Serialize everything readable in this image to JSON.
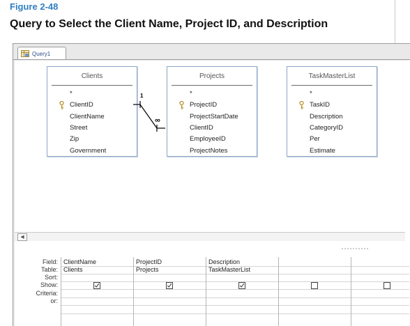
{
  "figure": {
    "label": "Figure 2-48",
    "title": "Query to Select the Client Name, Project ID, and Description"
  },
  "window": {
    "tab_label": "Query1",
    "tab_icon": "query-icon",
    "scroll_left_icon": "scroll-left-icon",
    "scroll_left_glyph": "◀"
  },
  "tables": [
    {
      "name": "Clients",
      "fields": [
        {
          "label": "*",
          "key": false
        },
        {
          "label": "ClientID",
          "key": true
        },
        {
          "label": "ClientName",
          "key": false
        },
        {
          "label": "Street",
          "key": false
        },
        {
          "label": "Zip",
          "key": false
        },
        {
          "label": "Government",
          "key": false
        }
      ]
    },
    {
      "name": "Projects",
      "fields": [
        {
          "label": "*",
          "key": false
        },
        {
          "label": "ProjectID",
          "key": true
        },
        {
          "label": "ProjectStartDate",
          "key": false
        },
        {
          "label": "ClientID",
          "key": false
        },
        {
          "label": "EmployeeID",
          "key": false
        },
        {
          "label": "ProjectNotes",
          "key": false
        }
      ]
    },
    {
      "name": "TaskMasterList",
      "fields": [
        {
          "label": "*",
          "key": false
        },
        {
          "label": "TaskID",
          "key": true
        },
        {
          "label": "Description",
          "key": false
        },
        {
          "label": "CategoryID",
          "key": false
        },
        {
          "label": "Per",
          "key": false
        },
        {
          "label": "Estimate",
          "key": false
        }
      ]
    }
  ],
  "relationship": {
    "one_side": "1",
    "many_side": "∞"
  },
  "grid": {
    "row_labels": {
      "field": "Field:",
      "table": "Table:",
      "sort": "Sort:",
      "show": "Show:",
      "criteria": "Criteria:",
      "or": "or:"
    },
    "columns": [
      {
        "field": "ClientName",
        "table": "Clients",
        "sort": "",
        "show": true,
        "criteria": "",
        "or": ""
      },
      {
        "field": "ProjectID",
        "table": "Projects",
        "sort": "",
        "show": true,
        "criteria": "",
        "or": ""
      },
      {
        "field": "Description",
        "table": "TaskMasterList",
        "sort": "",
        "show": true,
        "criteria": "",
        "or": ""
      },
      {
        "field": "",
        "table": "",
        "sort": "",
        "show": false,
        "criteria": "",
        "or": ""
      },
      {
        "field": "",
        "table": "",
        "sort": "",
        "show": false,
        "criteria": "",
        "or": ""
      }
    ]
  },
  "colors": {
    "figure_label": "#2f7ec2",
    "table_border": "#8aa6c8",
    "key_icon": "#b8962e"
  }
}
